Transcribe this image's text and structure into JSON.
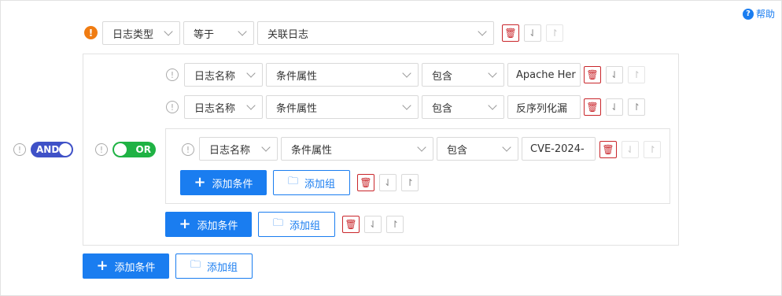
{
  "help": {
    "label": "帮助",
    "icon": "help-circle-icon"
  },
  "root": {
    "logic_label": "AND",
    "warning_icon": "warning-icon",
    "condition": {
      "field": "日志类型",
      "operator": "等于",
      "value": "关联日志"
    },
    "add_condition_label": "添加条件",
    "add_group_label": "添加组"
  },
  "group1": {
    "logic_label": "OR",
    "rows": [
      {
        "field": "日志名称",
        "attribute": "条件属性",
        "operator": "包含",
        "value": "Apache Her"
      },
      {
        "field": "日志名称",
        "attribute": "条件属性",
        "operator": "包含",
        "value": "反序列化漏"
      }
    ],
    "add_condition_label": "添加条件",
    "add_group_label": "添加组"
  },
  "group2": {
    "rows": [
      {
        "field": "日志名称",
        "attribute": "条件属性",
        "operator": "包含",
        "value": "CVE-2024-"
      }
    ],
    "add_condition_label": "添加条件",
    "add_group_label": "添加组"
  },
  "colors": {
    "primary": "#1a7df0",
    "danger": "#c9262b",
    "warning": "#f07c12",
    "and_toggle": "#3f51c7",
    "or_toggle": "#1fb244"
  }
}
